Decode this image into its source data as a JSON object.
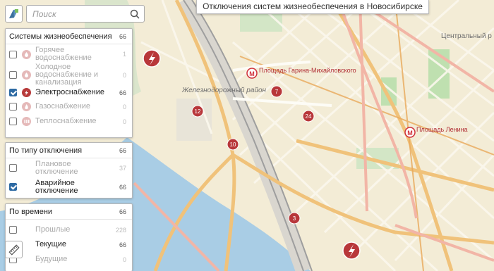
{
  "title": "Отключения систем жизнеобеспечения в Новосибирске",
  "search": {
    "placeholder": "Поиск"
  },
  "systems": {
    "header": "Системы жизнеобеспечения",
    "count": "66",
    "items": [
      {
        "label": "Горячее водоснабжение",
        "count": "1",
        "checked": false
      },
      {
        "label": "Холодное водоснабжение и канализация",
        "count": "0",
        "checked": false
      },
      {
        "label": "Электроснабжение",
        "count": "66",
        "checked": true
      },
      {
        "label": "Газоснабжение",
        "count": "0",
        "checked": false
      },
      {
        "label": "Теплоснабжение",
        "count": "0",
        "checked": false
      }
    ]
  },
  "by_type": {
    "header": "По типу отключения",
    "count": "66",
    "items": [
      {
        "label": "Плановое отключение",
        "count": "37",
        "checked": false
      },
      {
        "label": "Аварийное отключение",
        "count": "66",
        "checked": true
      }
    ]
  },
  "by_time": {
    "header": "По времени",
    "count": "66",
    "items": [
      {
        "label": "Прошлые",
        "count": "228",
        "checked": false
      },
      {
        "label": "Текущие",
        "count": "66",
        "checked": true
      },
      {
        "label": "Будущие",
        "count": "0",
        "checked": false
      }
    ]
  },
  "map": {
    "district": "Железнодорожный район",
    "central_district": "Центральный р",
    "metro": [
      "Площадь Гарина-Михайловского",
      "Площадь Ленина"
    ],
    "clusters": [
      "7",
      "12",
      "24",
      "10",
      "3"
    ],
    "metro_letter": "M"
  },
  "colors": {
    "marker": "#b8373a",
    "river": "#a7cbe3",
    "metro": "#d0313a"
  }
}
